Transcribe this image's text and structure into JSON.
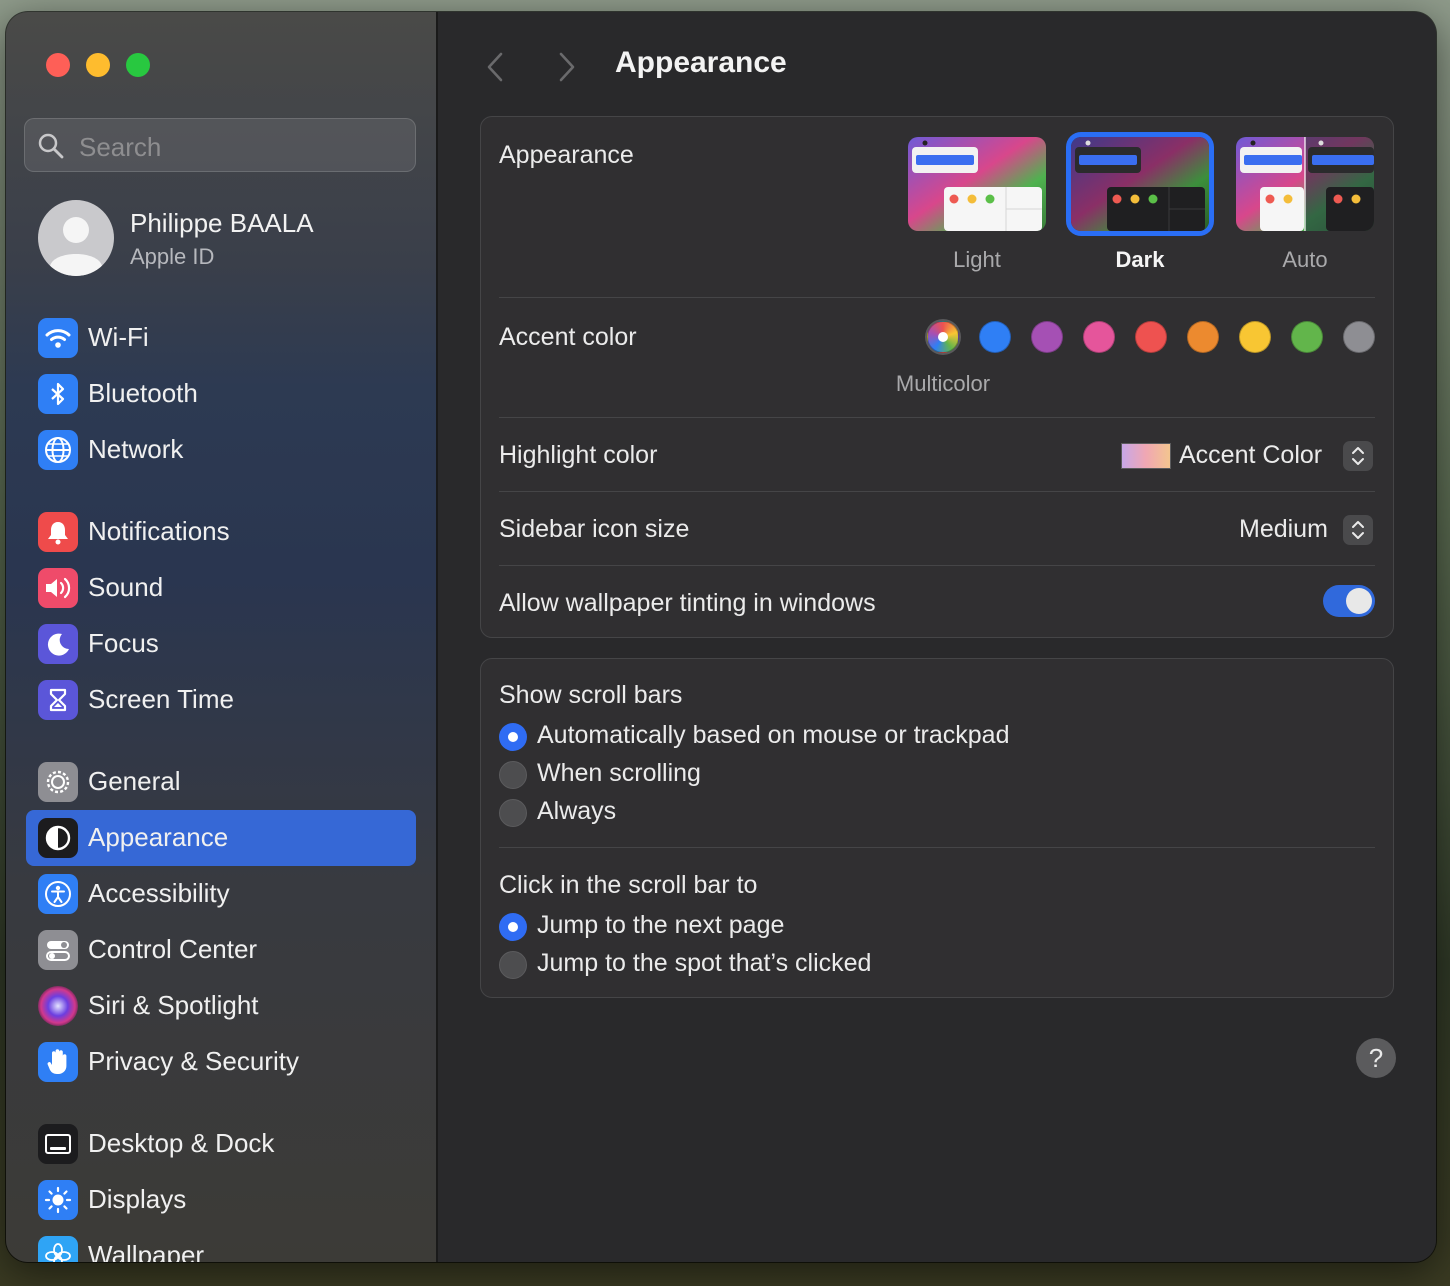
{
  "window": {
    "title": "Appearance"
  },
  "search": {
    "placeholder": "Search"
  },
  "profile": {
    "name": "Philippe BAALA",
    "subtitle": "Apple ID"
  },
  "sidebar": {
    "items": [
      {
        "label": "Wi-Fi",
        "icon": "wifi-icon",
        "color": "#2f7ff5"
      },
      {
        "label": "Bluetooth",
        "icon": "bluetooth-icon",
        "color": "#2f7ff5"
      },
      {
        "label": "Network",
        "icon": "globe-icon",
        "color": "#2f7ff5"
      },
      {
        "label": "Notifications",
        "icon": "bell-icon",
        "color": "#ef4b4b"
      },
      {
        "label": "Sound",
        "icon": "speaker-icon",
        "color": "#ef4b6a"
      },
      {
        "label": "Focus",
        "icon": "moon-icon",
        "color": "#5b56d9"
      },
      {
        "label": "Screen Time",
        "icon": "hourglass-icon",
        "color": "#5b56d9"
      },
      {
        "label": "General",
        "icon": "gear-icon",
        "color": "#8e8e93"
      },
      {
        "label": "Appearance",
        "icon": "appearance-icon",
        "color": "#1c1c1e",
        "selected": true
      },
      {
        "label": "Accessibility",
        "icon": "accessibility-icon",
        "color": "#2f7ff5"
      },
      {
        "label": "Control Center",
        "icon": "control-center-icon",
        "color": "#8e8e93"
      },
      {
        "label": "Siri & Spotlight",
        "icon": "siri-icon",
        "color": "#7a3cd6"
      },
      {
        "label": "Privacy & Security",
        "icon": "hand-icon",
        "color": "#2f7ff5"
      },
      {
        "label": "Desktop & Dock",
        "icon": "dock-icon",
        "color": "#1c1c1e"
      },
      {
        "label": "Displays",
        "icon": "sun-icon",
        "color": "#2f7ff5"
      },
      {
        "label": "Wallpaper",
        "icon": "flower-icon",
        "color": "#2fa4f5"
      }
    ]
  },
  "appearance": {
    "label": "Appearance",
    "options": [
      {
        "label": "Light"
      },
      {
        "label": "Dark",
        "selected": true
      },
      {
        "label": "Auto"
      }
    ]
  },
  "accent": {
    "label": "Accent color",
    "selected_label": "Multicolor",
    "colors": [
      "multicolor",
      "#2f7ff5",
      "#a550b4",
      "#e5559b",
      "#ee5250",
      "#ec8a2f",
      "#f8c633",
      "#62b54b",
      "#8e8e93"
    ]
  },
  "highlight": {
    "label": "Highlight color",
    "value": "Accent Color"
  },
  "sidebar_icon_size": {
    "label": "Sidebar icon size",
    "value": "Medium"
  },
  "tinting": {
    "label": "Allow wallpaper tinting in windows",
    "enabled": true
  },
  "scroll_bars": {
    "label": "Show scroll bars",
    "options": [
      {
        "label": "Automatically based on mouse or trackpad",
        "selected": true
      },
      {
        "label": "When scrolling",
        "selected": false
      },
      {
        "label": "Always",
        "selected": false
      }
    ]
  },
  "click_scroll": {
    "label": "Click in the scroll bar to",
    "options": [
      {
        "label": "Jump to the next page",
        "selected": true
      },
      {
        "label": "Jump to the spot that’s clicked",
        "selected": false
      }
    ]
  },
  "help": {
    "label": "?"
  }
}
